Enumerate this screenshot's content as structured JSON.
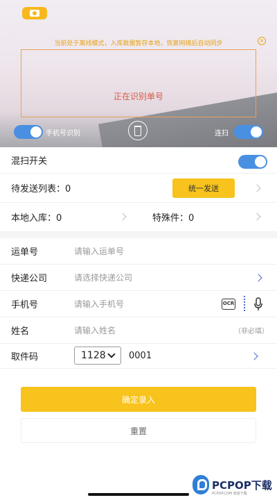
{
  "scanner": {
    "offline_tip": "当前处于离线模式，入库数据暂存本地，恢复网络后自动同步",
    "status": "正在识别单号",
    "phone_recognition_label": "手机号识别",
    "continuous_label": "连扫"
  },
  "mixed_scan": {
    "label": "混扫开关"
  },
  "pending": {
    "label": "待发送列表：0",
    "send_button": "统一发送"
  },
  "stats": {
    "local_label": "本地入库：0",
    "special_label": "特殊件：0"
  },
  "form": {
    "waybill": {
      "label": "运单号",
      "placeholder": "请输入运单号"
    },
    "courier": {
      "label": "快递公司",
      "placeholder": "请选择快递公司"
    },
    "phone": {
      "label": "手机号",
      "placeholder": "请输入手机号",
      "ocr": "OCR"
    },
    "name": {
      "label": "姓名",
      "placeholder": "请输入姓名",
      "optional": "（非必填）"
    },
    "pickup": {
      "label": "取件码",
      "prefix": "1128",
      "number": "0001"
    }
  },
  "actions": {
    "confirm": "确定录入",
    "reset": "重置"
  },
  "watermark": {
    "brand": "PCPOP下载",
    "sub": "PCPOP.COM 泡泡下载"
  },
  "colors": {
    "accent": "#f7c31c",
    "toggle": "#4a90e2",
    "link": "#4a63c9"
  }
}
